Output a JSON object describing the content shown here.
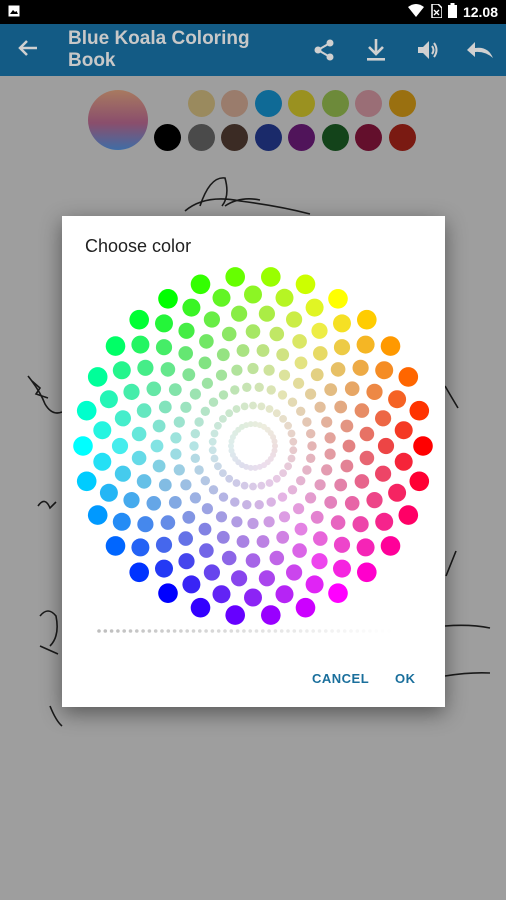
{
  "status_bar": {
    "time": "12.08"
  },
  "app_bar": {
    "title": "Blue Koala Coloring Book",
    "back_icon": "arrow-back-icon",
    "actions": [
      "share-icon",
      "download-icon",
      "volume-icon",
      "undo-icon"
    ]
  },
  "palette": {
    "colors_top": [
      "#9e9e9e",
      "#9a8a5e",
      "#9a7c6c",
      "#0f6a96",
      "#9a9120",
      "#6d8a3a",
      "#9a6e76",
      "#9a7010"
    ],
    "colors_bottom": [
      "#000000",
      "#4a4a4a",
      "#3b2b24",
      "#1a2a6a",
      "#50145a",
      "#13431a",
      "#630f2c",
      "#7a1a12"
    ]
  },
  "dialog": {
    "title": "Choose color",
    "cancel_label": "CANCEL",
    "ok_label": "OK"
  }
}
